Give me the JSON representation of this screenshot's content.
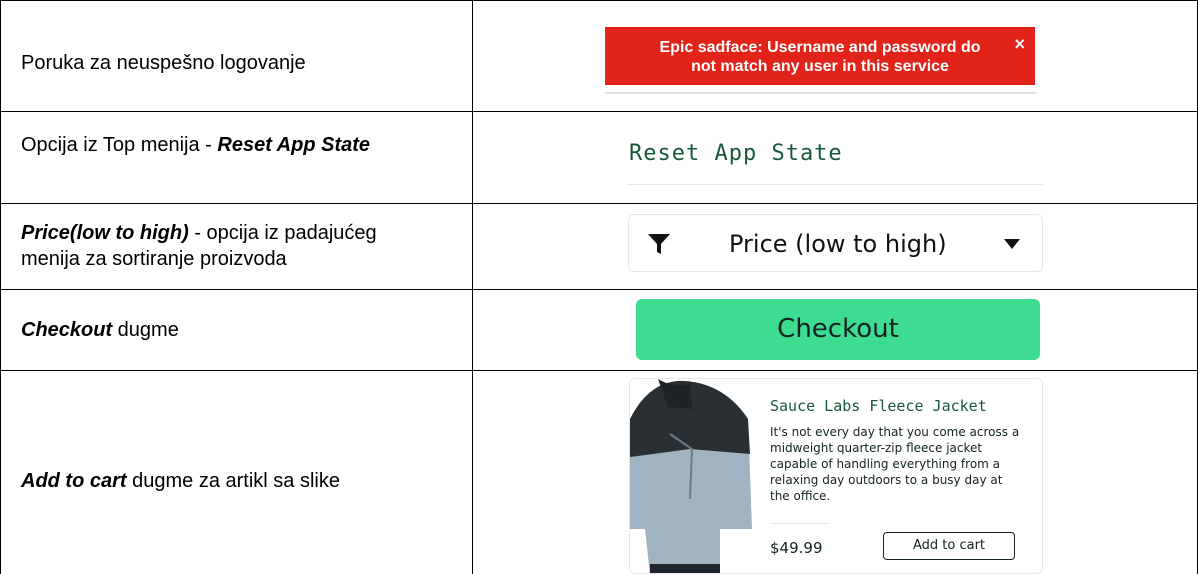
{
  "rows": [
    {
      "label_plain": "Poruka za neuspešno logovanje"
    },
    {
      "label_plain": "Opcija iz Top menija - ",
      "label_emph": "Reset App State"
    },
    {
      "label_emph": "Price(low to high)",
      "label_plain": " - opcija iz padajućeg",
      "label_plain2": "menija za sortiranje proizvoda"
    },
    {
      "label_emph": "Checkout",
      "label_plain": " dugme"
    },
    {
      "label_emph": "Add to cart",
      "label_plain": " dugme za artikl sa slike"
    }
  ],
  "error_message": {
    "line1": "Epic sadface: Username and password do",
    "line2": "not match any user in this service",
    "close_glyph": "×"
  },
  "menu": {
    "reset_label": "Reset App State"
  },
  "sort": {
    "selected": "Price (low to high)"
  },
  "checkout": {
    "label": "Checkout"
  },
  "product": {
    "name": "Sauce Labs Fleece Jacket",
    "description": "It's not every day that you come across a midweight quarter-zip fleece jacket capable of handling everything from a relaxing day outdoors to a busy day at the office.",
    "price": "$49.99",
    "add_label": "Add to cart"
  },
  "colors": {
    "error_bg": "#e2231a",
    "checkout_bg": "#3ddc91",
    "brand_green": "#18583a"
  }
}
